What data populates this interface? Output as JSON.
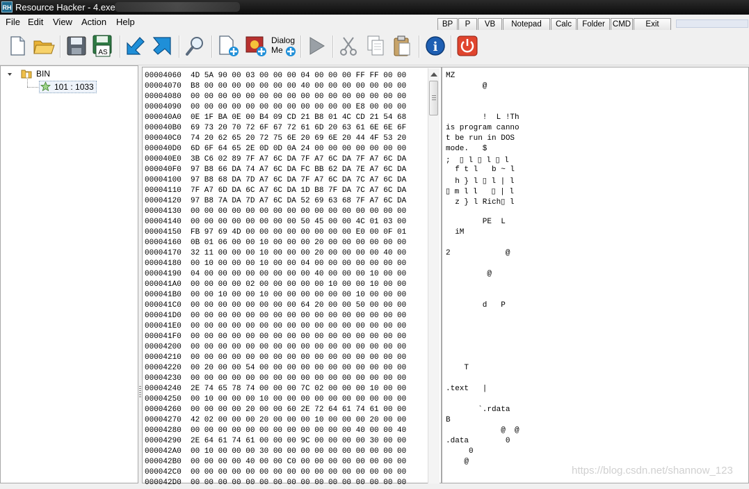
{
  "window": {
    "app_icon": "RH",
    "title": "Resource Hacker - 4.exe"
  },
  "menu": [
    "File",
    "Edit",
    "View",
    "Action",
    "Help"
  ],
  "quick_buttons": [
    "BP",
    "P",
    "VB",
    "Notepad",
    "Calc",
    "Folder",
    "CMD",
    "Exit"
  ],
  "toolbar": [
    {
      "name": "new-file-icon"
    },
    {
      "name": "open-folder-icon"
    },
    {
      "name": "save-icon"
    },
    {
      "name": "save-as-icon",
      "label": "AS"
    },
    {
      "name": "compile-icon"
    },
    {
      "name": "goto-icon"
    },
    {
      "name": "find-icon"
    },
    {
      "name": "add-resource-icon"
    },
    {
      "name": "add-image-icon"
    },
    {
      "name": "dialog-menu-icon",
      "label1": "Dialog",
      "label2": "Me"
    },
    {
      "name": "play-icon"
    },
    {
      "name": "cut-icon"
    },
    {
      "name": "copy-icon"
    },
    {
      "name": "paste-icon"
    },
    {
      "name": "info-icon",
      "label": "i"
    },
    {
      "name": "power-icon"
    }
  ],
  "tree": {
    "root": "BIN",
    "child": "101 : 1033"
  },
  "hex_rows": [
    {
      "addr": "00004060",
      "bytes": "4D 5A 90 00 03 00 00 00 04 00 00 00 FF FF 00 00"
    },
    {
      "addr": "00004070",
      "bytes": "B8 00 00 00 00 00 00 00 40 00 00 00 00 00 00 00"
    },
    {
      "addr": "00004080",
      "bytes": "00 00 00 00 00 00 00 00 00 00 00 00 00 00 00 00"
    },
    {
      "addr": "00004090",
      "bytes": "00 00 00 00 00 00 00 00 00 00 00 00 E8 00 00 00"
    },
    {
      "addr": "000040A0",
      "bytes": "0E 1F BA 0E 00 B4 09 CD 21 B8 01 4C CD 21 54 68"
    },
    {
      "addr": "000040B0",
      "bytes": "69 73 20 70 72 6F 67 72 61 6D 20 63 61 6E 6E 6F"
    },
    {
      "addr": "000040C0",
      "bytes": "74 20 62 65 20 72 75 6E 20 69 6E 20 44 4F 53 20"
    },
    {
      "addr": "000040D0",
      "bytes": "6D 6F 64 65 2E 0D 0D 0A 24 00 00 00 00 00 00 00"
    },
    {
      "addr": "000040E0",
      "bytes": "3B C6 02 89 7F A7 6C DA 7F A7 6C DA 7F A7 6C DA"
    },
    {
      "addr": "000040F0",
      "bytes": "97 B8 66 DA 74 A7 6C DA FC BB 62 DA 7E A7 6C DA"
    },
    {
      "addr": "00004100",
      "bytes": "97 B8 68 DA 7D A7 6C DA 7F A7 6C DA 7C A7 6C DA"
    },
    {
      "addr": "00004110",
      "bytes": "7F A7 6D DA 6C A7 6C DA 1D B8 7F DA 7C A7 6C DA"
    },
    {
      "addr": "00004120",
      "bytes": "97 B8 7A DA 7D A7 6C DA 52 69 63 68 7F A7 6C DA"
    },
    {
      "addr": "00004130",
      "bytes": "00 00 00 00 00 00 00 00 00 00 00 00 00 00 00 00"
    },
    {
      "addr": "00004140",
      "bytes": "00 00 00 00 00 00 00 00 50 45 00 00 4C 01 03 00"
    },
    {
      "addr": "00004150",
      "bytes": "FB 97 69 4D 00 00 00 00 00 00 00 00 E0 00 0F 01"
    },
    {
      "addr": "00004160",
      "bytes": "0B 01 06 00 00 10 00 00 00 20 00 00 00 00 00 00"
    },
    {
      "addr": "00004170",
      "bytes": "32 11 00 00 00 10 00 00 00 20 00 00 00 00 40 00"
    },
    {
      "addr": "00004180",
      "bytes": "00 10 00 00 00 10 00 00 04 00 00 00 00 00 00 00"
    },
    {
      "addr": "00004190",
      "bytes": "04 00 00 00 00 00 00 00 00 40 00 00 00 10 00 00"
    },
    {
      "addr": "000041A0",
      "bytes": "00 00 00 00 02 00 00 00 00 00 10 00 00 10 00 00"
    },
    {
      "addr": "000041B0",
      "bytes": "00 00 10 00 00 10 00 00 00 00 00 00 10 00 00 00"
    },
    {
      "addr": "000041C0",
      "bytes": "00 00 00 00 00 00 00 00 64 20 00 00 50 00 00 00"
    },
    {
      "addr": "000041D0",
      "bytes": "00 00 00 00 00 00 00 00 00 00 00 00 00 00 00 00"
    },
    {
      "addr": "000041E0",
      "bytes": "00 00 00 00 00 00 00 00 00 00 00 00 00 00 00 00"
    },
    {
      "addr": "000041F0",
      "bytes": "00 00 00 00 00 00 00 00 00 00 00 00 00 00 00 00"
    },
    {
      "addr": "00004200",
      "bytes": "00 00 00 00 00 00 00 00 00 00 00 00 00 00 00 00"
    },
    {
      "addr": "00004210",
      "bytes": "00 00 00 00 00 00 00 00 00 00 00 00 00 00 00 00"
    },
    {
      "addr": "00004220",
      "bytes": "00 20 00 00 54 00 00 00 00 00 00 00 00 00 00 00"
    },
    {
      "addr": "00004230",
      "bytes": "00 00 00 00 00 00 00 00 00 00 00 00 00 00 00 00"
    },
    {
      "addr": "00004240",
      "bytes": "2E 74 65 78 74 00 00 00 7C 02 00 00 00 10 00 00"
    },
    {
      "addr": "00004250",
      "bytes": "00 10 00 00 00 10 00 00 00 00 00 00 00 00 00 00"
    },
    {
      "addr": "00004260",
      "bytes": "00 00 00 00 20 00 00 60 2E 72 64 61 74 61 00 00"
    },
    {
      "addr": "00004270",
      "bytes": "42 02 00 00 00 20 00 00 00 10 00 00 00 20 00 00"
    },
    {
      "addr": "00004280",
      "bytes": "00 00 00 00 00 00 00 00 00 00 00 00 40 00 00 40"
    },
    {
      "addr": "00004290",
      "bytes": "2E 64 61 74 61 00 00 00 9C 00 00 00 00 30 00 00"
    },
    {
      "addr": "000042A0",
      "bytes": "00 10 00 00 00 30 00 00 00 00 00 00 00 00 00 00"
    },
    {
      "addr": "000042B0",
      "bytes": "00 00 00 00 40 00 00 C0 00 00 00 00 00 00 00 00"
    },
    {
      "addr": "000042C0",
      "bytes": "00 00 00 00 00 00 00 00 00 00 00 00 00 00 00 00"
    },
    {
      "addr": "000042D0",
      "bytes": "00 00 00 00 00 00 00 00 00 00 00 00 00 00 00 00"
    }
  ],
  "text_rows": [
    "MZ",
    "        @",
    "",
    "",
    "        !  L !Th",
    "is program canno",
    "t be run in DOS",
    "mode.   $",
    ";  ▯ l ▯ l ▯ l",
    "  f t l   b ~ l",
    "  h } l ▯ l | l",
    "▯ m l l   ▯ | l",
    "  z } l Rich▯ l",
    "",
    "        PE  L",
    "  iM",
    "",
    "2            @",
    "",
    "         @",
    "",
    "",
    "        d   P",
    "",
    "",
    "",
    "",
    "",
    "    T",
    "",
    ".text   |",
    "",
    "       `.rdata",
    "B",
    "            @  @",
    ".data        0",
    "     0",
    "    @",
    "",
    ""
  ],
  "watermark": "https://blog.csdn.net/shannow_123"
}
